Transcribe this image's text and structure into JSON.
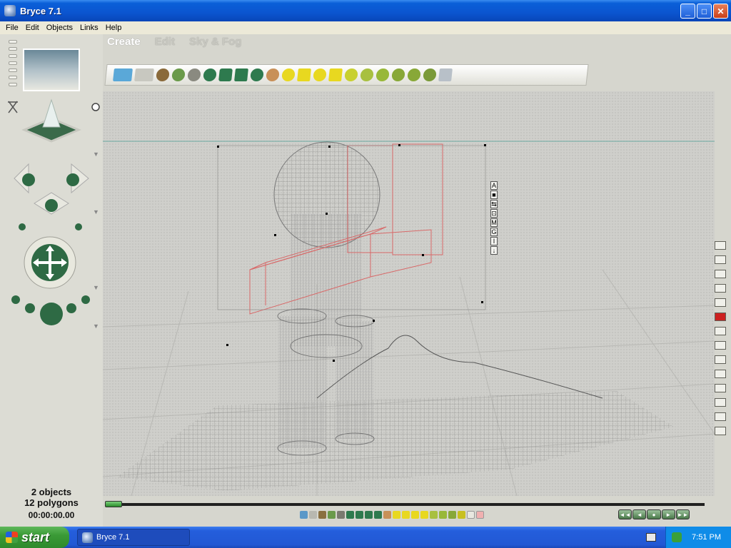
{
  "window": {
    "title": "Bryce 7.1"
  },
  "menu": [
    "File",
    "Edit",
    "Objects",
    "Links",
    "Help"
  ],
  "palette_tabs": [
    "Create",
    "Edit",
    "Sky & Fog"
  ],
  "selection_tools": [
    "A",
    "■",
    "⇆",
    "⊡",
    "M",
    "G",
    "I",
    "↓"
  ],
  "status": {
    "objects": "2 objects",
    "polygons": "12 polygons",
    "time": "00:00:00.00"
  },
  "taskbar": {
    "start_label": "start",
    "task_label": "Bryce 7.1",
    "clock": "7:51 PM"
  }
}
